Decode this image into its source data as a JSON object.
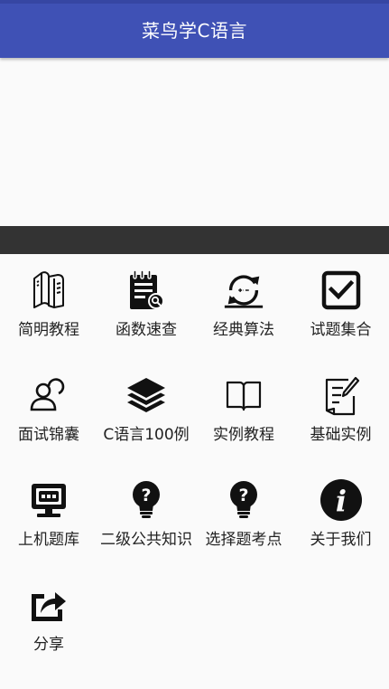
{
  "app": {
    "title": "菜鸟学C语言"
  },
  "menu": [
    {
      "label": "简明教程",
      "icon": "books-icon"
    },
    {
      "label": "函数速查",
      "icon": "function-search-icon"
    },
    {
      "label": "经典算法",
      "icon": "refresh-algorithm-icon"
    },
    {
      "label": "试题集合",
      "icon": "checkbox-icon"
    },
    {
      "label": "面试锦囊",
      "icon": "interview-users-icon"
    },
    {
      "label": "C语言100例",
      "icon": "layers-icon"
    },
    {
      "label": "实例教程",
      "icon": "open-book-icon"
    },
    {
      "label": "基础实例",
      "icon": "edit-document-icon"
    },
    {
      "label": "上机题库",
      "icon": "computer-icon"
    },
    {
      "label": "二级公共知识",
      "icon": "question-bulb-icon"
    },
    {
      "label": "选择题考点",
      "icon": "question-bulb-icon"
    },
    {
      "label": "关于我们",
      "icon": "info-icon"
    },
    {
      "label": "分享",
      "icon": "share-icon"
    }
  ],
  "colors": {
    "toolbar": "#3f51b5",
    "divider": "#333333",
    "icon": "#111111"
  }
}
